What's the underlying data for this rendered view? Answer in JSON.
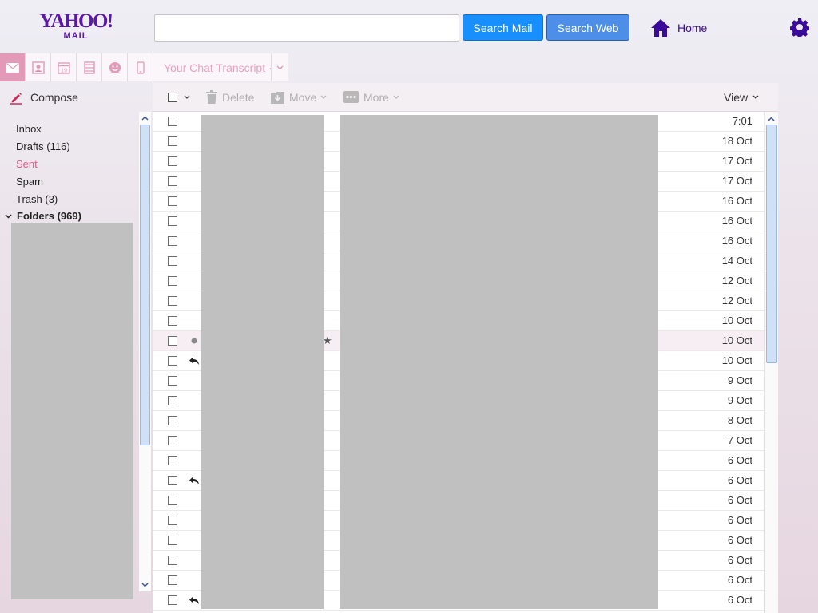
{
  "header": {
    "logo_line1": "YAHOO!",
    "logo_line2": "MAIL",
    "search_value": "",
    "search_mail_label": "Search Mail",
    "search_web_label": "Search Web",
    "home_label": "Home",
    "brand_color": "#5a1aa6"
  },
  "appbar": {
    "chat_tab_label": "Your Chat Transcript ·",
    "apps": [
      "mail-icon",
      "contacts-icon",
      "calendar-icon",
      "notepad-icon",
      "messenger-icon",
      "mobile-icon"
    ]
  },
  "sidebar": {
    "compose_label": "Compose",
    "items": [
      {
        "label": "Inbox"
      },
      {
        "label": "Drafts (116)"
      },
      {
        "label": "Sent"
      },
      {
        "label": "Spam"
      },
      {
        "label": "Trash (3)"
      }
    ],
    "folders_label": "Folders (969)"
  },
  "toolbar": {
    "delete_label": "Delete",
    "move_label": "Move",
    "more_label": "More",
    "view_label": "View"
  },
  "messages": [
    {
      "date": "7:01",
      "icon": ""
    },
    {
      "date": "18 Oct",
      "icon": ""
    },
    {
      "date": "17 Oct",
      "icon": ""
    },
    {
      "date": "17 Oct",
      "icon": ""
    },
    {
      "date": "16 Oct",
      "icon": ""
    },
    {
      "date": "16 Oct",
      "icon": ""
    },
    {
      "date": "16 Oct",
      "icon": ""
    },
    {
      "date": "14 Oct",
      "icon": ""
    },
    {
      "date": "12 Oct",
      "icon": ""
    },
    {
      "date": "12 Oct",
      "icon": ""
    },
    {
      "date": "10 Oct",
      "icon": ""
    },
    {
      "date": "10 Oct",
      "icon": "dot",
      "starred": true
    },
    {
      "date": "10 Oct",
      "icon": "reply"
    },
    {
      "date": "9 Oct",
      "icon": ""
    },
    {
      "date": "9 Oct",
      "icon": ""
    },
    {
      "date": "8 Oct",
      "icon": ""
    },
    {
      "date": "7 Oct",
      "icon": ""
    },
    {
      "date": "6 Oct",
      "icon": ""
    },
    {
      "date": "6 Oct",
      "icon": "reply"
    },
    {
      "date": "6 Oct",
      "icon": ""
    },
    {
      "date": "6 Oct",
      "icon": ""
    },
    {
      "date": "6 Oct",
      "icon": ""
    },
    {
      "date": "6 Oct",
      "icon": ""
    },
    {
      "date": "6 Oct",
      "icon": ""
    },
    {
      "date": "6 Oct",
      "icon": "reply"
    }
  ]
}
